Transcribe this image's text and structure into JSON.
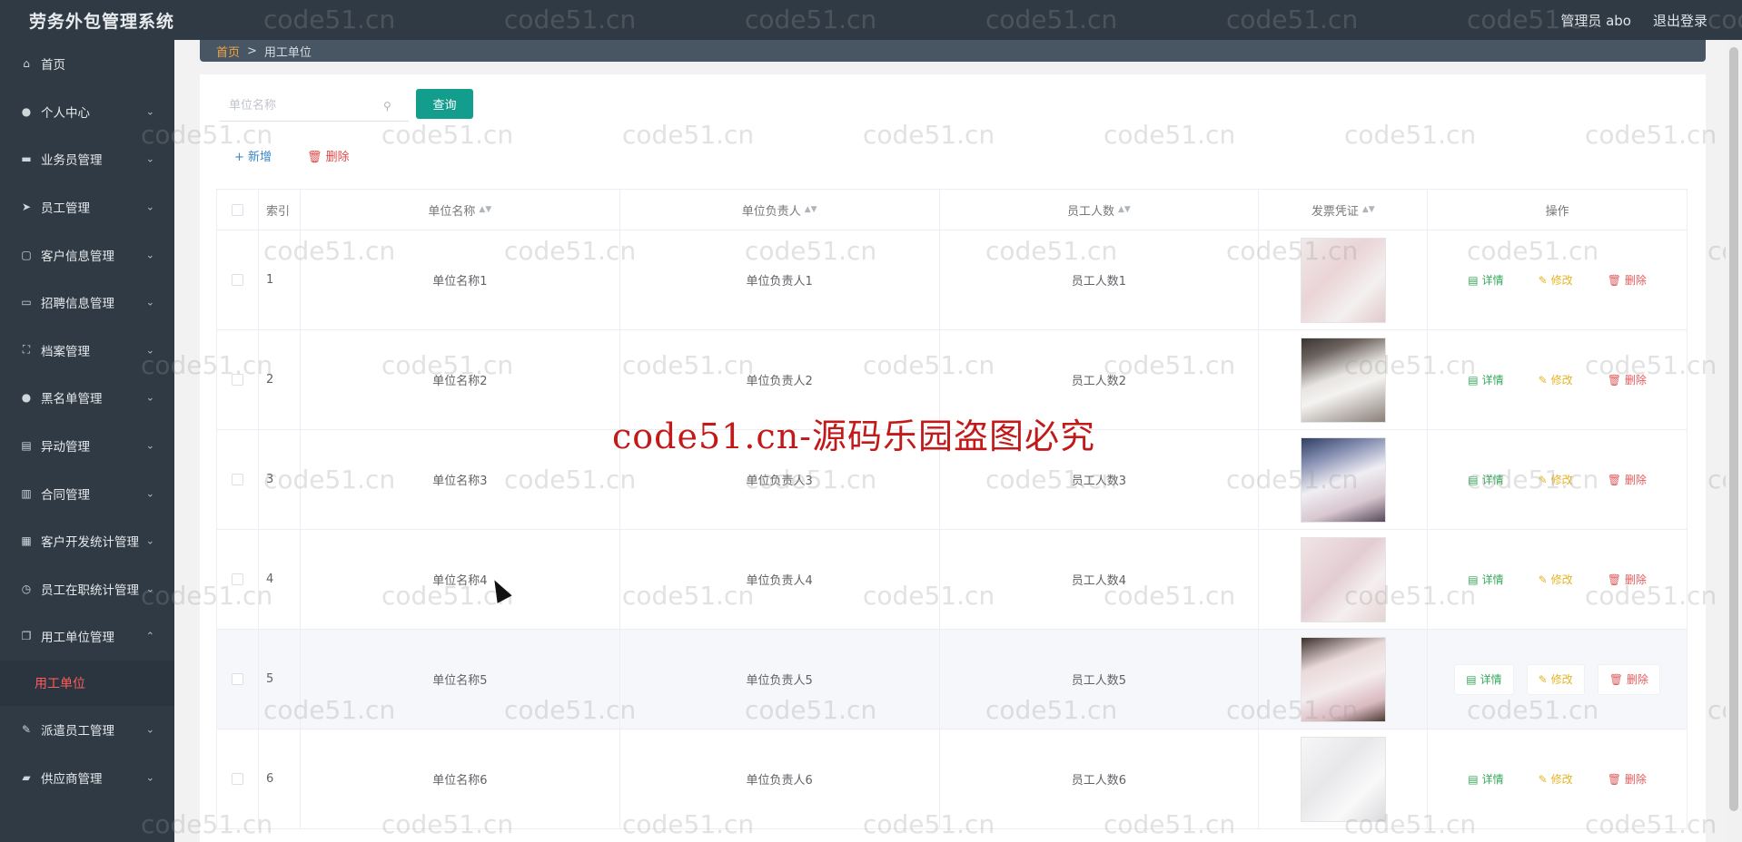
{
  "app": {
    "title": "劳务外包管理系统"
  },
  "header": {
    "user_label": "管理员 abo",
    "logout_label": "退出登录"
  },
  "sidebar": {
    "items": [
      {
        "label": "首页",
        "icon": "home-icon",
        "glyph": "⌂",
        "expandable": false
      },
      {
        "label": "个人中心",
        "icon": "user-icon",
        "glyph": "●",
        "expandable": true
      },
      {
        "label": "业务员管理",
        "icon": "chat-icon",
        "glyph": "▬",
        "expandable": true
      },
      {
        "label": "员工管理",
        "icon": "send-icon",
        "glyph": "➤",
        "expandable": true
      },
      {
        "label": "客户信息管理",
        "icon": "crop-icon",
        "glyph": "▢",
        "expandable": true
      },
      {
        "label": "招聘信息管理",
        "icon": "message-icon",
        "glyph": "▭",
        "expandable": true
      },
      {
        "label": "档案管理",
        "icon": "fullscreen-icon",
        "glyph": "⛶",
        "expandable": true
      },
      {
        "label": "黑名单管理",
        "icon": "user-solid-icon",
        "glyph": "●",
        "expandable": true
      },
      {
        "label": "异动管理",
        "icon": "document-icon",
        "glyph": "▤",
        "expandable": true
      },
      {
        "label": "合同管理",
        "icon": "data-analysis-icon",
        "glyph": "▥",
        "expandable": true
      },
      {
        "label": "客户开发统计管理",
        "icon": "grid-icon",
        "glyph": "▦",
        "expandable": true
      },
      {
        "label": "员工在职统计管理",
        "icon": "stopwatch-icon",
        "glyph": "◷",
        "expandable": true
      },
      {
        "label": "用工单位管理",
        "icon": "copy-document-icon",
        "glyph": "❐",
        "expandable": true,
        "expanded": true
      }
    ],
    "sub_item": "用工单位",
    "items_after": [
      {
        "label": "派遣员工管理",
        "icon": "edit-icon",
        "glyph": "✎",
        "expandable": true
      },
      {
        "label": "供应商管理",
        "icon": "film-icon",
        "glyph": "▰",
        "expandable": true
      }
    ]
  },
  "breadcrumb": {
    "home": "首页",
    "separator": ">",
    "current": "用工单位"
  },
  "search": {
    "placeholder": "单位名称",
    "value": "",
    "button": "查询"
  },
  "actions": {
    "add": "+ 新增",
    "delete": "删除"
  },
  "table": {
    "columns": [
      "索引",
      "单位名称",
      "单位负责人",
      "员工人数",
      "发票凭证",
      "操作"
    ],
    "rows": [
      {
        "index": "1",
        "name": "单位名称1",
        "head": "单位负责人1",
        "count": "员工人数1",
        "thumb": "invoice-stamp-red"
      },
      {
        "index": "2",
        "name": "单位名称2",
        "head": "单位负责人2",
        "count": "员工人数2",
        "thumb": "invoice-held-dark"
      },
      {
        "index": "3",
        "name": "单位名称3",
        "head": "单位负责人3",
        "count": "员工人数3",
        "thumb": "invoice-held-blue"
      },
      {
        "index": "4",
        "name": "单位名称4",
        "head": "单位负责人4",
        "count": "员工人数4",
        "thumb": "invoice-stamp-pink"
      },
      {
        "index": "5",
        "name": "单位名称5",
        "head": "单位负责人5",
        "count": "员工人数5",
        "thumb": "invoice-fapiao"
      },
      {
        "index": "6",
        "name": "单位名称6",
        "head": "单位负责人6",
        "count": "员工人数6",
        "thumb": "invoice-white"
      }
    ],
    "row_actions": {
      "detail": "详情",
      "edit": "修改",
      "delete": "删除"
    },
    "hovered_row": 5
  },
  "watermark": {
    "text": "code51.cn",
    "banner": "code51.cn-源码乐园盗图必究"
  },
  "colors": {
    "topbar": "#303a44",
    "sidebar": "#2f3a44",
    "accent_teal": "#139d8c",
    "active_red": "#ff5b5b",
    "detail_green": "#35a85a",
    "edit_yellow": "#e6b422",
    "delete_red": "#e25b5b"
  }
}
